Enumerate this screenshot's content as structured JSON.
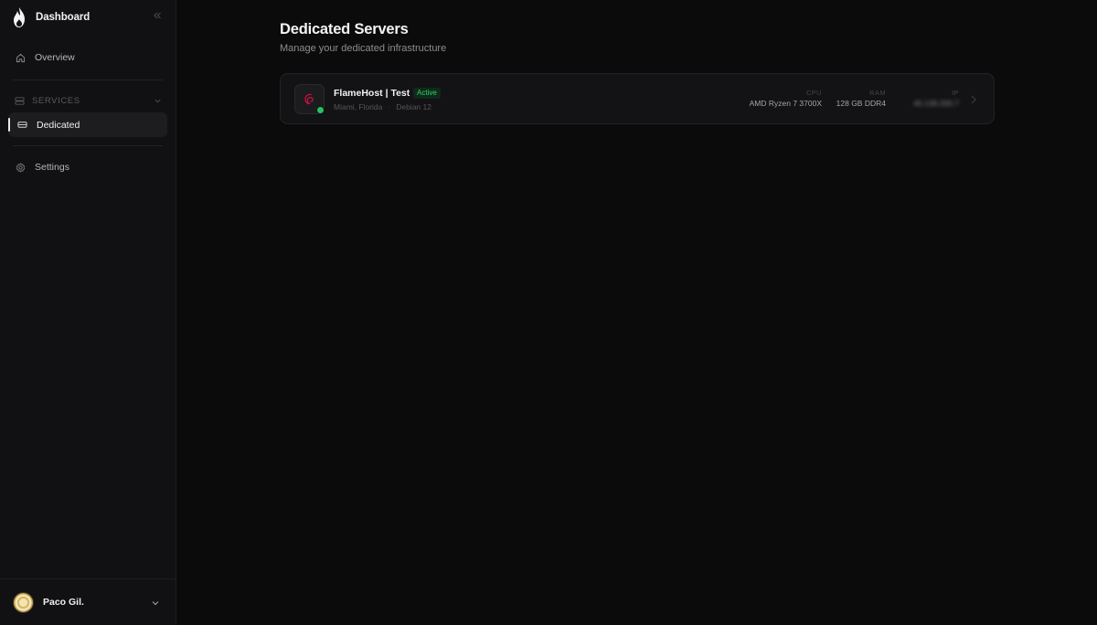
{
  "sidebar": {
    "brand_title": "Dashboard",
    "nav": {
      "overview_label": "Overview",
      "services_label": "SERVICES",
      "dedicated_label": "Dedicated",
      "settings_label": "Settings"
    },
    "user": {
      "name": "Paco Gil."
    }
  },
  "main": {
    "title": "Dedicated Servers",
    "subtitle": "Manage your dedicated infrastructure",
    "servers": [
      {
        "name": "FlameHost | Test",
        "status": "Active",
        "location": "Miami, Florida",
        "os": "Debian 12",
        "cpu_label": "CPU",
        "cpu": "AMD Ryzen 7 3700X",
        "ram_label": "RAM",
        "ram": "128 GB DDR4",
        "ip_label": "IP",
        "ip": "45.139.200.7"
      }
    ]
  },
  "colors": {
    "status_active": "#22c55e",
    "debian_red": "#c7113d",
    "background": "#0b0b0c",
    "sidebar": "#111113"
  },
  "icons": {
    "brand": "flame-logo",
    "collapse": "double-chevron-left-icon",
    "overview": "home-icon",
    "services": "server-stack-icon",
    "dedicated": "server-icon",
    "settings": "gear-icon",
    "os": "debian-logo"
  }
}
